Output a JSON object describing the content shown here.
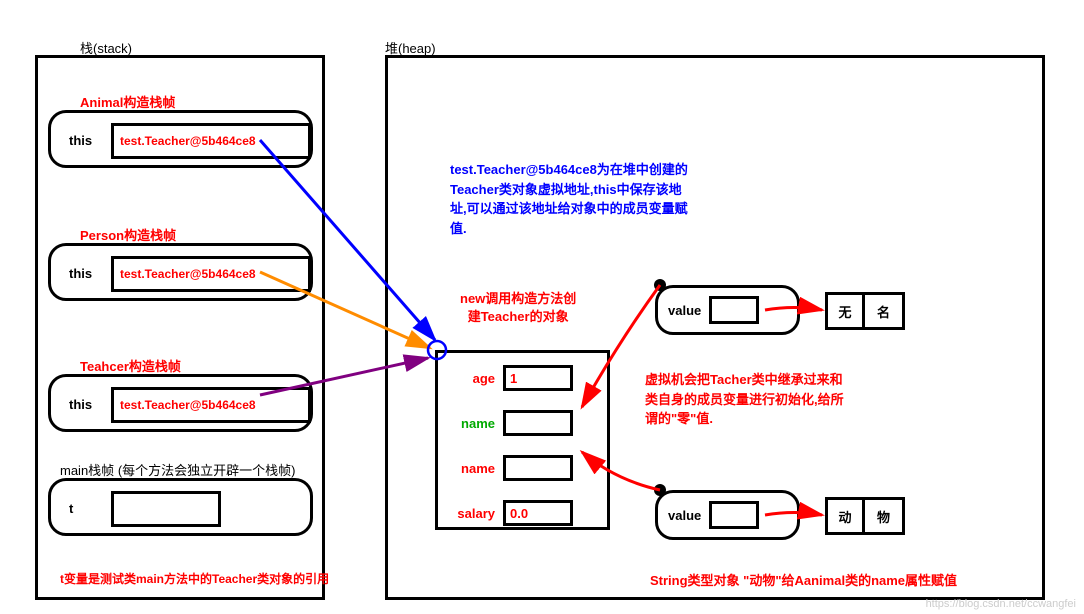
{
  "labels": {
    "stackTitle": "栈(stack)",
    "heapTitle": "堆(heap)"
  },
  "stack": {
    "frames": [
      {
        "caption": "Animal构造栈帧",
        "label": "this",
        "value": "test.Teacher@5b464ce8"
      },
      {
        "caption": "Person构造栈帧",
        "label": "this",
        "value": "test.Teacher@5b464ce8"
      },
      {
        "caption": "Teahcer构造栈帧",
        "label": "this",
        "value": "test.Teacher@5b464ce8"
      },
      {
        "caption": "main栈帧",
        "captionExtra": "(每个方法会独立开辟一个栈帧)",
        "label": "t",
        "value": ""
      }
    ],
    "tvarNote": "t变量是测试类main方法中的Teacher类对象的引用"
  },
  "heap": {
    "note": "test.Teacher@5b464ce8为在堆中创建的Teacher类对象虚拟地址,this中保存该地址,可以通过该地址给对象中的成员变量赋值.",
    "newNote1": "new调用构造方法创",
    "newNote2": "建Teacher的对象",
    "objFields": {
      "age": {
        "label": "age",
        "value": "1"
      },
      "nameGreen": {
        "label": "name",
        "value": ""
      },
      "nameRed": {
        "label": "name",
        "value": ""
      },
      "salary": {
        "label": "salary",
        "value": "0.0"
      }
    },
    "strObj1": {
      "label": "value",
      "chars": [
        "无",
        "名"
      ]
    },
    "strObj2": {
      "label": "value",
      "chars": [
        "动",
        "物"
      ]
    },
    "vmNote": "虚拟机会把Tacher类中继承过来和类自身的成员变量进行初始化,给所谓的\"零\"值.",
    "strNote": "String类型对象 \"动物\"给Aanimal类的name属性赋值"
  },
  "watermark": "https://blog.csdn.net/ccwangfei"
}
